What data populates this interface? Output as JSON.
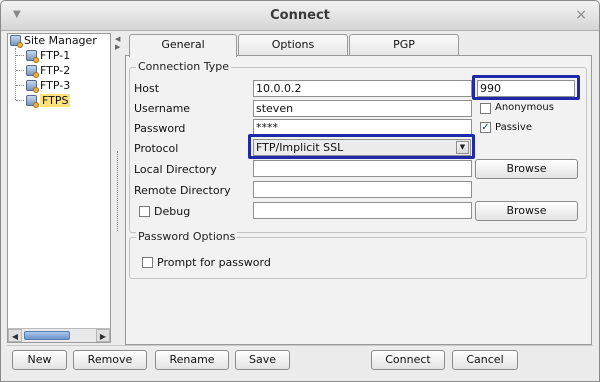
{
  "window": {
    "title": "Connect",
    "menu_glyph": "▼",
    "close_glyph": "×"
  },
  "tree": {
    "root": "Site Manager",
    "items": [
      {
        "label": "FTP-1",
        "selected": false
      },
      {
        "label": "FTP-2",
        "selected": false
      },
      {
        "label": "FTP-3",
        "selected": false
      },
      {
        "label": "FTPS",
        "selected": true
      }
    ],
    "scroll_left": "◀",
    "scroll_right": "▶"
  },
  "tabs": [
    {
      "label": "General",
      "active": true
    },
    {
      "label": "Options",
      "active": false
    },
    {
      "label": "PGP",
      "active": false
    }
  ],
  "connection": {
    "group_title": "Connection Type",
    "host_label": "Host",
    "host_value": "10.0.0.2",
    "port_value": "990",
    "username_label": "Username",
    "username_value": "steven",
    "anonymous_label": "Anonymous",
    "anonymous_checked": false,
    "password_label": "Password",
    "password_value": "****",
    "passive_label": "Passive",
    "passive_checked": true,
    "protocol_label": "Protocol",
    "protocol_value": "FTP/Implicit SSL",
    "local_dir_label": "Local Directory",
    "local_dir_value": "",
    "browse_local_label": "Browse",
    "remote_dir_label": "Remote Directory",
    "remote_dir_value": "",
    "debug_label": "Debug",
    "debug_checked": false,
    "debug_value": "",
    "browse_debug_label": "Browse"
  },
  "password_options": {
    "group_title": "Password Options",
    "prompt_label": "Prompt for password",
    "prompt_checked": false
  },
  "buttons": {
    "new": "New",
    "remove": "Remove",
    "rename": "Rename",
    "save": "Save",
    "connect": "Connect",
    "cancel": "Cancel"
  },
  "colors": {
    "highlight": "#1f2aa8",
    "selection": "#ffe27a"
  }
}
